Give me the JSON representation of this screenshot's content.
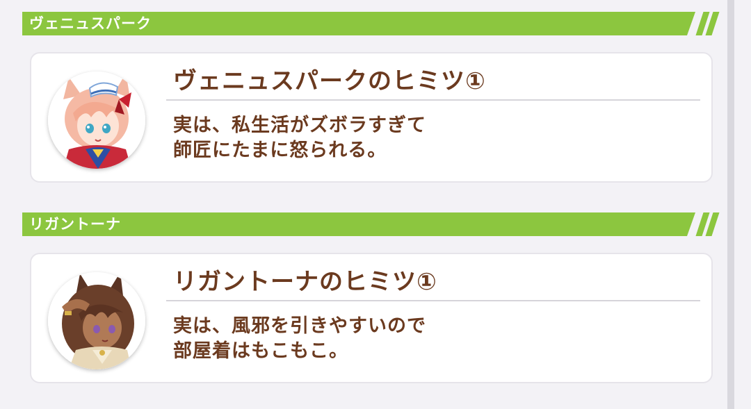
{
  "sections": [
    {
      "header": "ヴェニュスパーク",
      "card": {
        "title": "ヴェニュスパークのヒミツ①",
        "body_lines": [
          "実は、私生活がズボラすぎて",
          "師匠にたまに怒られる。"
        ]
      }
    },
    {
      "header": "リガントーナ",
      "card": {
        "title": "リガントーナのヒミツ①",
        "body_lines": [
          "実は、風邪を引きやすいので",
          "部屋着はもこもこ。"
        ]
      }
    }
  ],
  "colors": {
    "header_green": "#8cc63f",
    "text_brown": "#6b3a1f",
    "background": "#f3f2f6"
  }
}
